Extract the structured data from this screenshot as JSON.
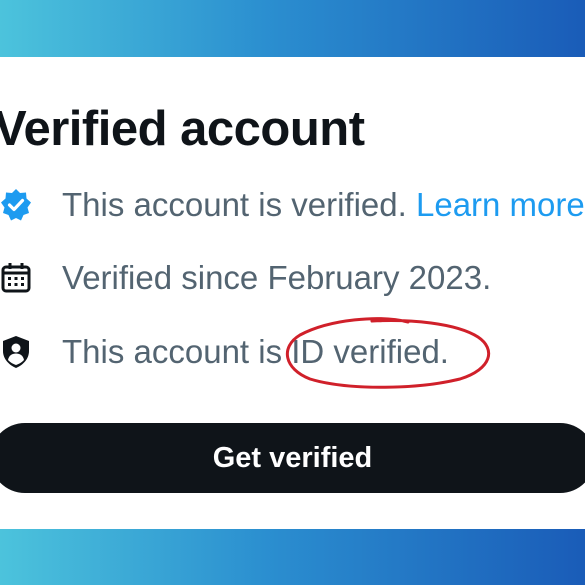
{
  "card": {
    "title": "Verified account",
    "rows": [
      {
        "icon": "verified-badge-icon",
        "text": "This account is verified. ",
        "link": "Learn more"
      },
      {
        "icon": "calendar-icon",
        "text": "Verified since February 2023."
      },
      {
        "icon": "id-shield-icon",
        "text": "This account is ID verified."
      }
    ],
    "button_label": "Get verified"
  },
  "colors": {
    "title": "#0f1419",
    "body_text": "#536471",
    "link": "#1d9bf0",
    "badge": "#1d9bf0",
    "button_bg": "#0f1419",
    "annotation": "#d0202a",
    "frame_gradient_start": "#4cc3dc",
    "frame_gradient_end": "#1a5cb8"
  }
}
